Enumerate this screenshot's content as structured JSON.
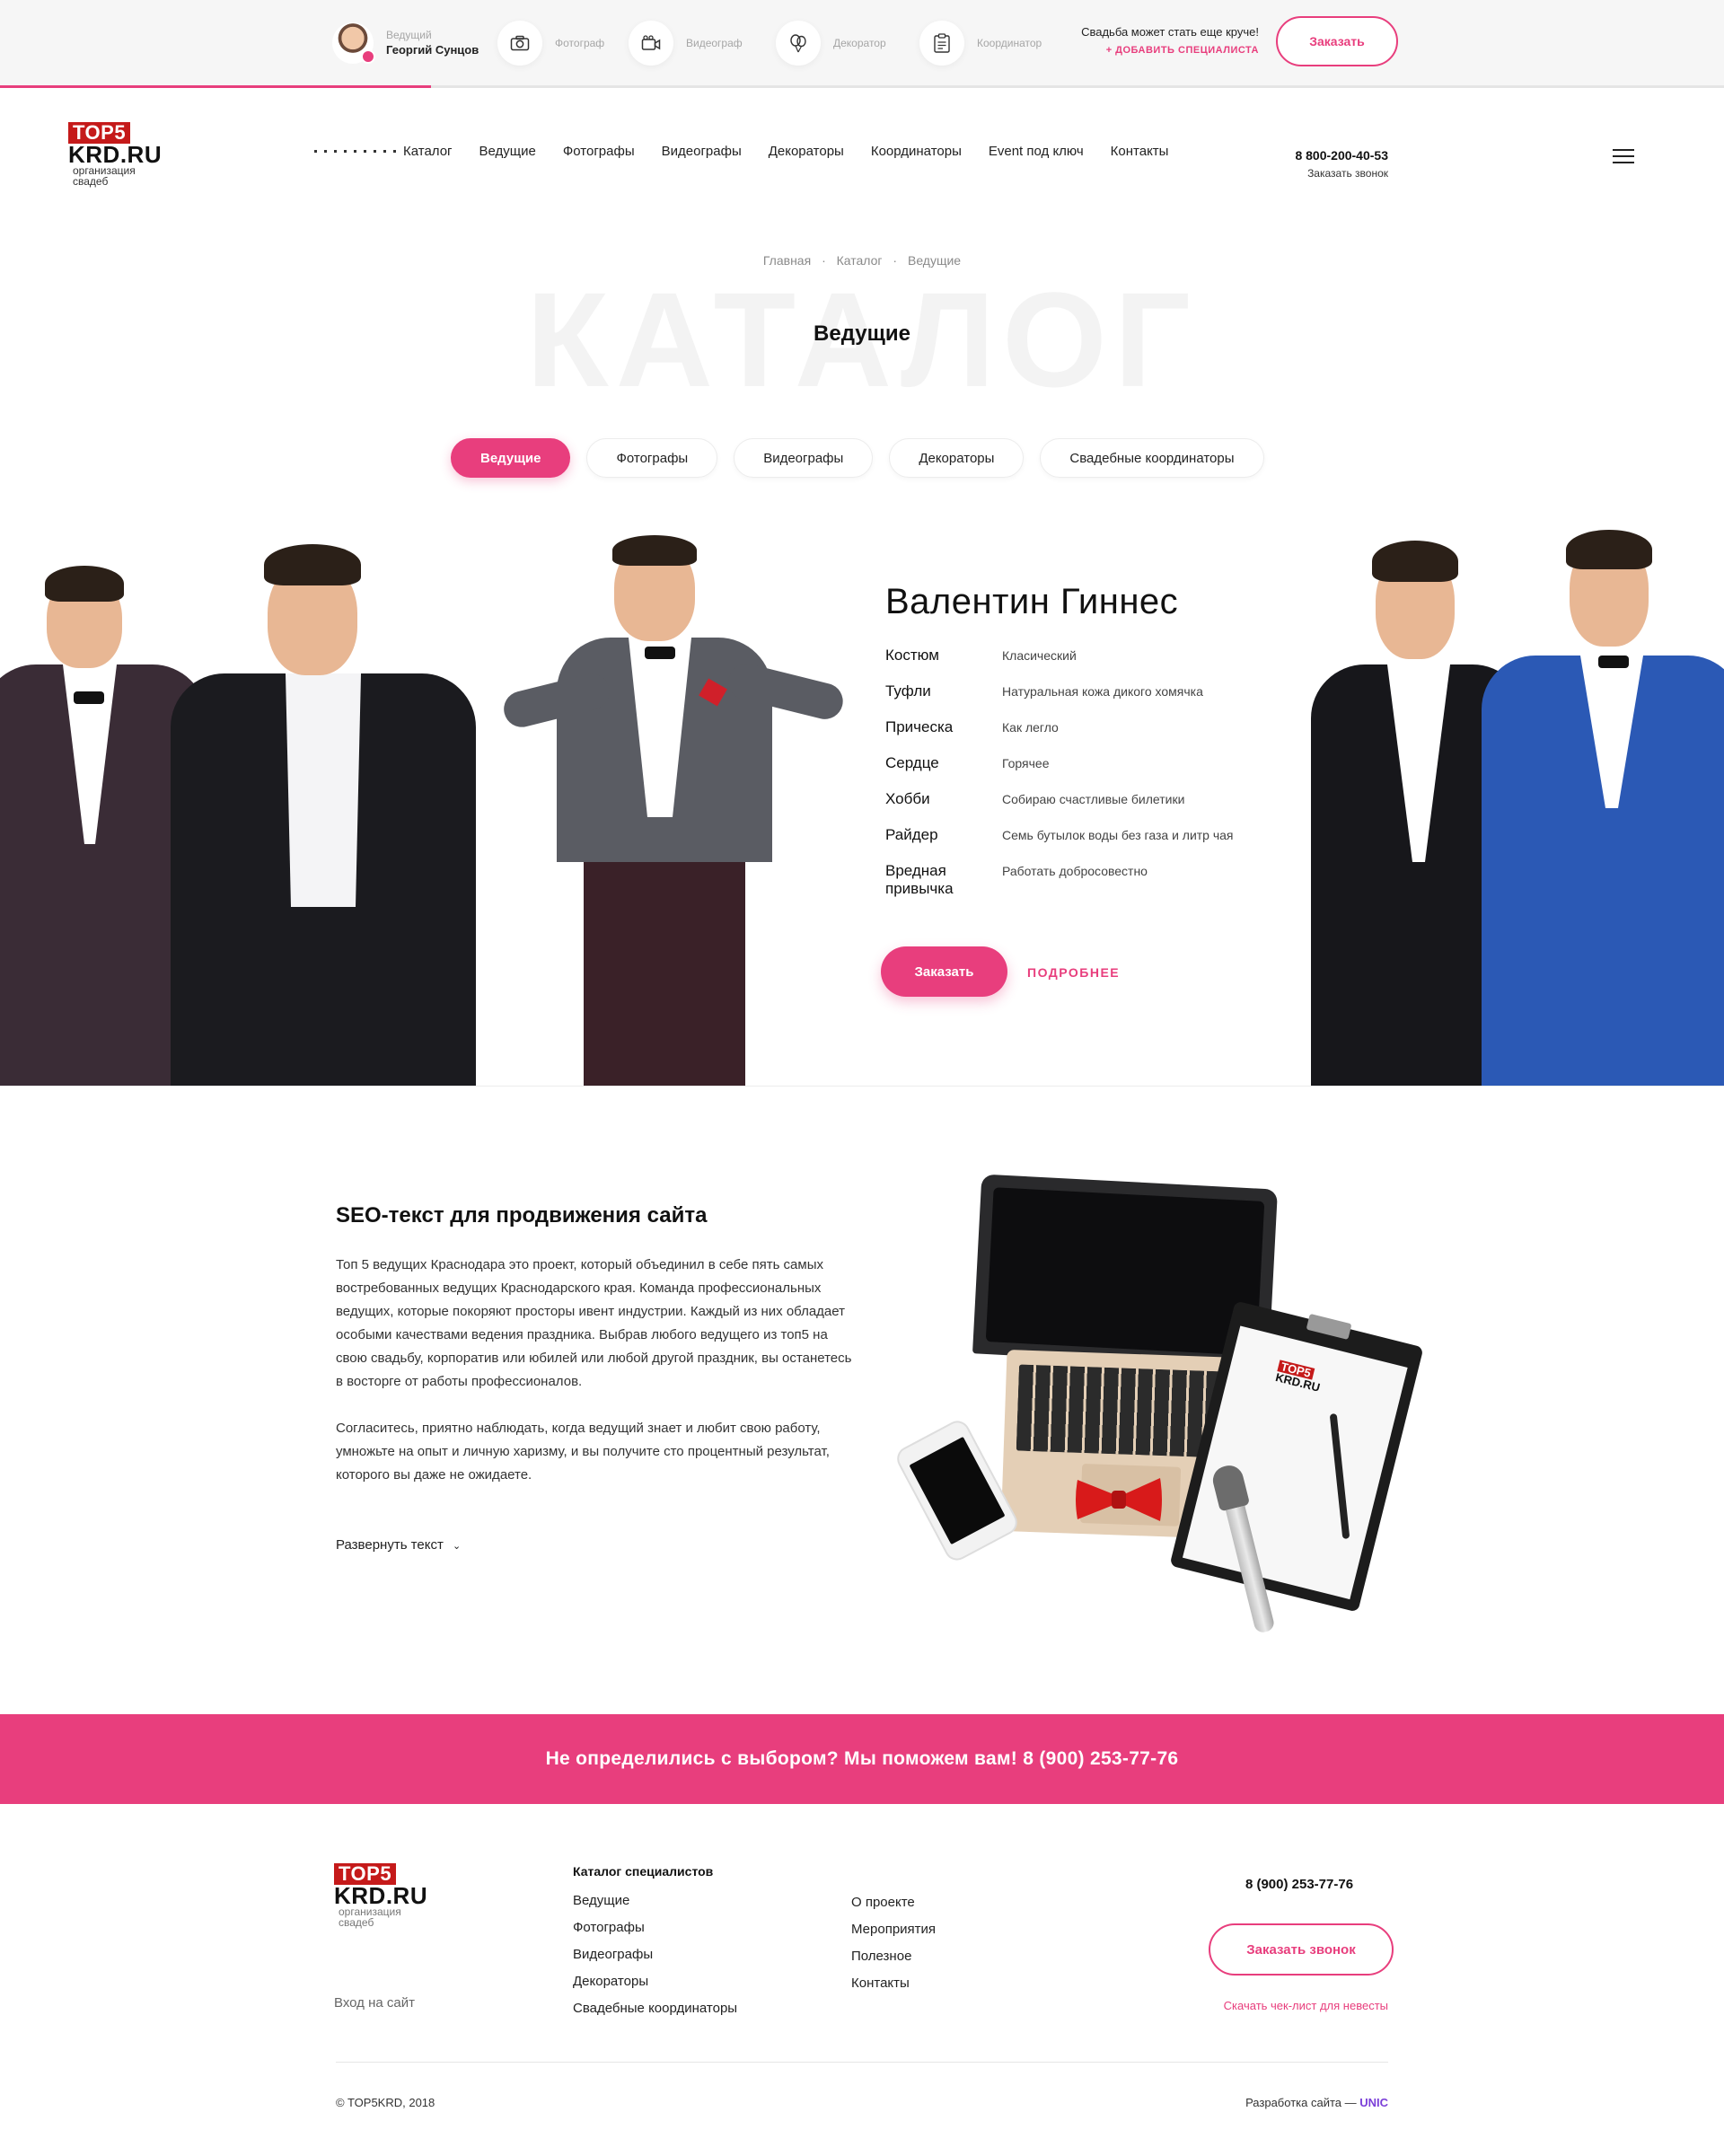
{
  "topbar": {
    "host_role": "Ведущий",
    "host_name": "Георгий Сунцов",
    "specialists": [
      {
        "label": "Фотограф",
        "icon": "camera-icon"
      },
      {
        "label": "Видеограф",
        "icon": "video-camera-icon"
      },
      {
        "label": "Декоратор",
        "icon": "balloons-icon"
      },
      {
        "label": "Координатор",
        "icon": "clipboard-icon"
      }
    ],
    "promo_text": "Свадьба может стать еще круче!",
    "add_specialist": "+ ДОБАВИТЬ СПЕЦИАЛИСТА",
    "order_button": "Заказать"
  },
  "header": {
    "logo_top": "TOP5",
    "logo_main": "KRD.RU",
    "logo_sub1": "организация",
    "logo_sub2": "свадеб",
    "nav": [
      "Каталог",
      "Ведущие",
      "Фотографы",
      "Видеографы",
      "Декораторы",
      "Координаторы",
      "Event под ключ",
      "Контакты"
    ],
    "phone": "8 800-200-40-53",
    "callback": "Заказать звонок"
  },
  "catalog": {
    "breadcrumbs": [
      "Главная",
      "Каталог",
      "Ведущие"
    ],
    "watermark": "КАТАЛОГ",
    "title": "Ведущие",
    "tabs": [
      "Ведущие",
      "Фотографы",
      "Видеографы",
      "Декораторы",
      "Свадебные координаторы"
    ]
  },
  "hero": {
    "name": "Валентин Гиннес",
    "attributes": [
      {
        "key": "Костюм",
        "value": "Класический"
      },
      {
        "key": "Туфли",
        "value": "Натуральная кожа дикого хомячка"
      },
      {
        "key": "Прическа",
        "value": "Как легло"
      },
      {
        "key": "Сердце",
        "value": "Горячее"
      },
      {
        "key": "Хобби",
        "value": "Собираю счастливые билетики"
      },
      {
        "key": "Райдер",
        "value": "Семь бутылок воды без газа и литр чая"
      },
      {
        "key": "Вредная привычка",
        "value": "Работать добросовестно"
      }
    ],
    "order_button": "Заказать",
    "more_link": "ПОДРОБНЕЕ"
  },
  "seo": {
    "title": "SEO-текст для продвижения сайта",
    "paragraph1": "Топ 5 ведущих Краснодара это проект, который объединил в себе пять самых востребованных ведущих Краснодарского края. Команда профессиональных ведущих, которые покоряют просторы ивент индустрии. Каждый из них обладает особыми качествами ведения праздника. Выбрав любого ведущего из топ5 на свою свадьбу, корпоратив или юбилей или любой другой праздник, вы останетесь в восторге от работы профессионалов.",
    "paragraph2": "Согласитесь, приятно наблюдать, когда ведущий знает и любит свою работу, умножьте на опыт и личную харизму, и вы получите сто процентный результат, которого вы даже не ожидаете.",
    "expand": "Развернуть текст",
    "clipboard_logo_top": "TOP5",
    "clipboard_logo_main": "KRD.RU"
  },
  "banner": {
    "text": "Не определились с выбором? Мы поможем вам! 8 (900) 253-77-76"
  },
  "footer": {
    "logo_top": "TOP5",
    "logo_main": "KRD.RU",
    "logo_sub1": "организация",
    "logo_sub2": "свадеб",
    "login": "Вход на сайт",
    "catalog_title": "Каталог специалистов",
    "catalog_links": [
      "Ведущие",
      "Фотографы",
      "Видеографы",
      "Декораторы",
      "Свадебные координаторы"
    ],
    "info_links": [
      "О проекте",
      "Мероприятия",
      "Полезное",
      "Контакты"
    ],
    "phone": "8 (900) 253-77-76",
    "callback_button": "Заказать звонок",
    "checklist": "Скачать чек-лист для невесты",
    "copyright": "© TOP5KRD, 2018",
    "dev_prefix": "Разработка сайта — ",
    "dev_name": "UNIC"
  },
  "colors": {
    "accent": "#e83e7d",
    "logo_red": "#c51a1a",
    "dev_link": "#7b3fd8"
  }
}
